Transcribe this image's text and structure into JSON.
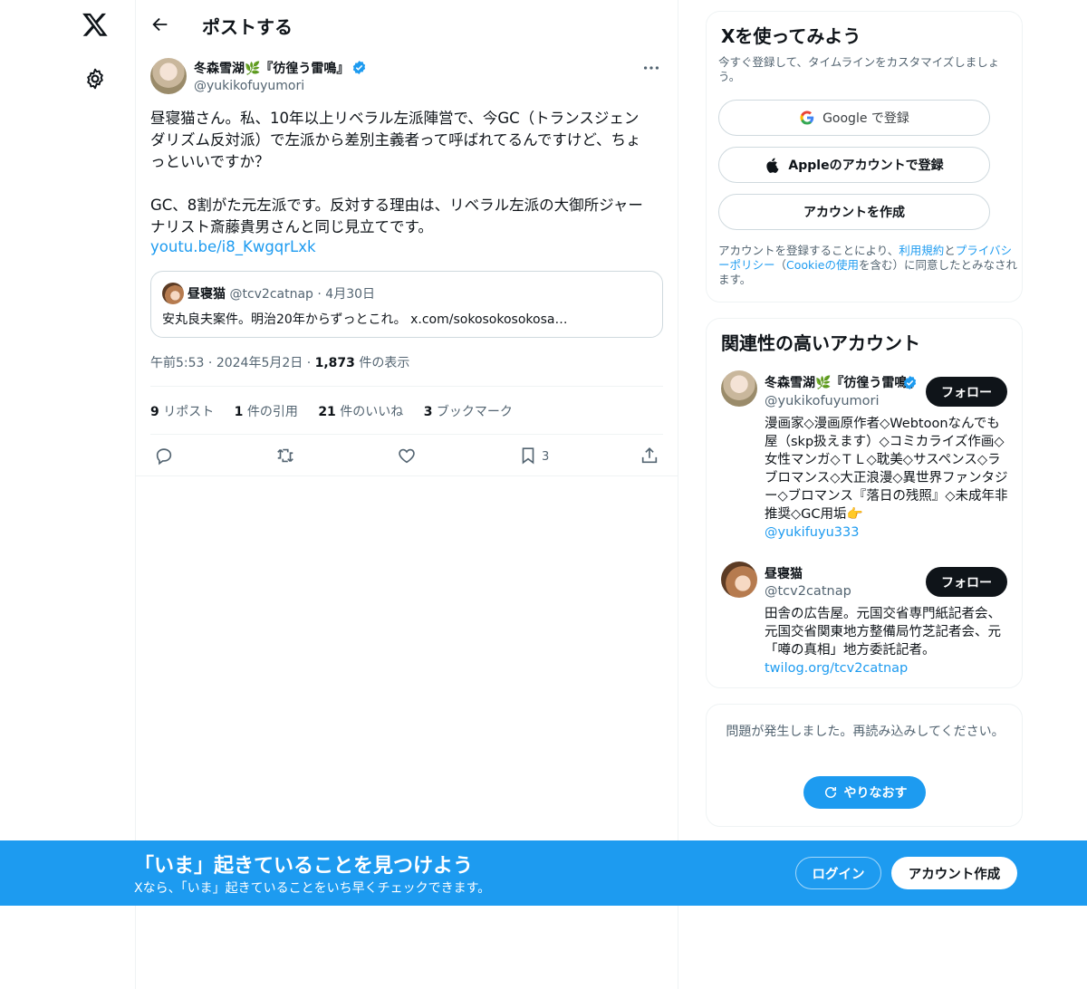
{
  "nav": {
    "logo": "x-logo-icon",
    "settings": "gear-icon"
  },
  "header": {
    "title": "ポストする"
  },
  "tweet": {
    "author_name": "冬森雪湖🌿『彷徨う雷鳴』",
    "author_handle": "@yukikofuyumori",
    "text": "昼寝猫さん。私、10年以上リベラル左派陣営で、今GC（トランスジェン\nダリズム反対派）で左派から差別主義者って呼ばれてるんですけど、ちょ\nっといいですか？\n\nGC、8割がた元左派です。反対する理由は、リベラル左派の大御所ジャー\nナリスト斎藤貴男さんと同じ見立てです。",
    "link": "youtu.be/i8_KwgqrLxk",
    "quote": {
      "name": "昼寝猫",
      "handle": "@tcv2catnap",
      "date": "4月30日",
      "text": "安丸良夫案件。明治20年からずっとこれ。 x.com/sokosokosokosa…"
    },
    "time": "午前5:53",
    "date": "2024年5月2日",
    "views_count": "1,873",
    "views_label": "件の表示",
    "stats": {
      "reposts_num": "9",
      "reposts_label": "リポスト",
      "quotes_num": "1",
      "quotes_label": "件の引用",
      "likes_num": "21",
      "likes_label": "件のいいね",
      "bookmarks_num": "3",
      "bookmarks_label": "ブックマーク"
    },
    "bookmark_count": "3"
  },
  "signup": {
    "title": "Xを使ってみよう",
    "subtitle": "今すぐ登録して、タイムラインをカスタマイズしましょう。",
    "google_label": "Google で登録",
    "apple_label": "Appleのアカウントで登録",
    "create_label": "アカウントを作成",
    "legal_1": "アカウントを登録することにより、",
    "legal_terms": "利用規約",
    "legal_2": "と",
    "legal_privacy": "プライバシーポリシー",
    "legal_3": "（",
    "legal_cookie": "Cookieの使用",
    "legal_4": "を含む）に同意したとみなされます。"
  },
  "related": {
    "title": "関連性の高いアカウント",
    "accounts": [
      {
        "name": "冬森雪湖🌿『彷徨う雷鳴』",
        "handle": "@yukikofuyumori",
        "bio": "漫画家◇漫画原作者◇Webtoonなんでも屋（skp扱えます）◇コミカライズ作画◇女性マンガ◇ＴＬ◇耽美◇サスペンス◇ラブロマンス◇大正浪漫◇異世界ファンタジー◇ブロマンス『落日の残照』◇未成年非推奨◇GC用垢👉",
        "bio_link": "@yukifuyu333",
        "follow": "フォロー"
      },
      {
        "name": "昼寝猫",
        "handle": "@tcv2catnap",
        "bio": "田舎の広告屋。元国交省専門紙記者会、元国交省関東地方整備局竹芝記者会、元「噂の真相」地方委託記者。",
        "bio_link": "twilog.org/tcv2catnap",
        "follow": "フォロー"
      }
    ]
  },
  "error": {
    "message": "問題が発生しました。再読み込みしてください。",
    "retry": "やりなおす"
  },
  "banner": {
    "title": "「いま」起きていることを見つけよう",
    "subtitle": "Xなら、「いま」起きていることをいち早くチェックできます。",
    "login": "ログイン",
    "signup": "アカウント作成"
  },
  "colors": {
    "accent": "#1d9bf0",
    "text": "#0f1419",
    "secondary": "#536471"
  }
}
